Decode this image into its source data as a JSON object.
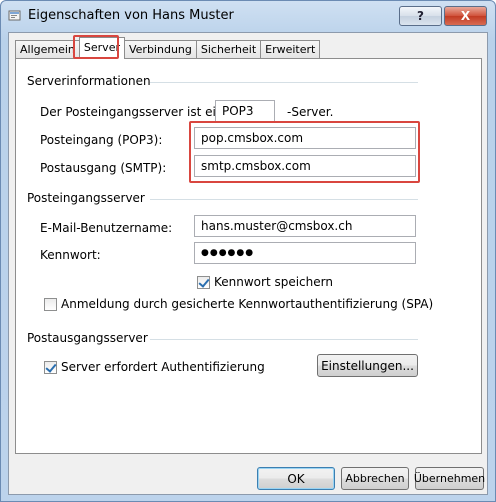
{
  "window": {
    "title": "Eigenschaften von Hans Muster",
    "help_label": "?",
    "close_label": "X"
  },
  "tabs": [
    {
      "label": "Allgemein"
    },
    {
      "label": "Server"
    },
    {
      "label": "Verbindung"
    },
    {
      "label": "Sicherheit"
    },
    {
      "label": "Erweitert"
    }
  ],
  "server_info": {
    "heading": "Serverinformationen",
    "incoming_type_prefix": "Der Posteingangsserver ist ein",
    "incoming_type_value": "POP3",
    "incoming_type_suffix": "-Server.",
    "incoming_label": "Posteingang (POP3):",
    "incoming_value": "pop.cmsbox.com",
    "outgoing_label": "Postausgang (SMTP):",
    "outgoing_value": "smtp.cmsbox.com"
  },
  "incoming_server": {
    "heading": "Posteingangsserver",
    "username_label": "E-Mail-Benutzername:",
    "username_value": "hans.muster@cmsbox.ch",
    "password_label": "Kennwort:",
    "password_value": "●●●●●●",
    "remember_password_label": "Kennwort speichern",
    "remember_password_checked": true,
    "spa_label": "Anmeldung durch gesicherte Kennwortauthentifizierung (SPA)",
    "spa_checked": false
  },
  "outgoing_server": {
    "heading": "Postausgangsserver",
    "auth_required_label": "Server erfordert Authentifizierung",
    "auth_required_checked": true,
    "settings_button": "Einstellungen..."
  },
  "footer": {
    "ok": "OK",
    "cancel": "Abbrechen",
    "apply": "Übernehmen"
  },
  "colors": {
    "highlight": "#d9463f"
  }
}
